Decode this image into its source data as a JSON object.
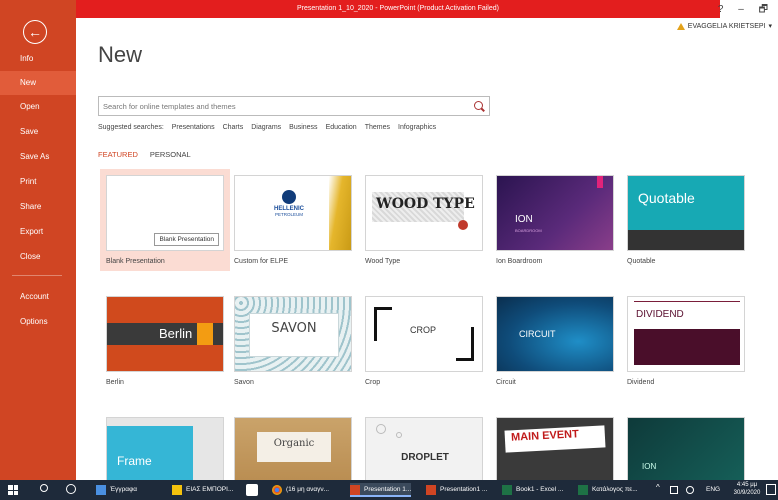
{
  "window": {
    "title": "Presentation 1_10_2020 - PowerPoint (Product Activation Failed)",
    "controls": "?  –  🗗",
    "user": "EVAGGELIA KRIETSEPI",
    "user_caret": "▾"
  },
  "sidebar": {
    "back": "←",
    "items": [
      {
        "label": "Info"
      },
      {
        "label": "New"
      },
      {
        "label": "Open"
      },
      {
        "label": "Save"
      },
      {
        "label": "Save As"
      },
      {
        "label": "Print"
      },
      {
        "label": "Share"
      },
      {
        "label": "Export"
      },
      {
        "label": "Close"
      },
      {
        "label": "Account"
      },
      {
        "label": "Options"
      }
    ]
  },
  "main": {
    "title": "New",
    "search_placeholder": "Search for online templates and themes",
    "suggested_label": "Suggested searches:",
    "suggested": [
      "Presentations",
      "Charts",
      "Diagrams",
      "Business",
      "Education",
      "Themes",
      "Infographics"
    ],
    "tabs": [
      {
        "label": "FEATURED"
      },
      {
        "label": "PERSONAL"
      }
    ],
    "tooltip": "Blank Presentation",
    "templates": [
      {
        "name": "Blank Presentation"
      },
      {
        "name": "Custom for ELPE",
        "brand1": "HELLENIC",
        "brand2": "PETROLEUM"
      },
      {
        "name": "Wood Type",
        "text": "WOOD TYPE"
      },
      {
        "name": "Ion Boardroom",
        "text": "ION",
        "sub": "BOARDROOM"
      },
      {
        "name": "Quotable",
        "text": "Quotable"
      },
      {
        "name": "Berlin",
        "text": "Berlin"
      },
      {
        "name": "Savon",
        "text": "SAVON"
      },
      {
        "name": "Crop",
        "text": "CROP"
      },
      {
        "name": "Circuit",
        "text": "CIRCUIT"
      },
      {
        "name": "Dividend",
        "text": "DIVIDEND"
      },
      {
        "name": "Frame",
        "text": "Frame"
      },
      {
        "name": "Organic",
        "text": "Organic"
      },
      {
        "name": "Droplet",
        "text": "DROPLET"
      },
      {
        "name": "Main Event",
        "text": "MAIN EVENT"
      },
      {
        "name": "Ion",
        "text": "ION"
      }
    ]
  },
  "taskbar": {
    "items": [
      {
        "label": "Έγγραφα"
      },
      {
        "label": "ΕΙΑΣ ΕΜΠΟΡΙ..."
      },
      {
        "label": "(16 μη αναγν..."
      },
      {
        "label": "Presentation 1..."
      },
      {
        "label": "Presentation1 ..."
      },
      {
        "label": "Book1 - Excel ..."
      },
      {
        "label": "Κατάλογος πε..."
      }
    ],
    "lang": "ENG",
    "time": "4:45 μμ",
    "date": "30/9/2020"
  },
  "colors": {
    "accent": "#d04523",
    "title_bar": "#e31e1e",
    "taskbar": "#1e2a3a"
  }
}
